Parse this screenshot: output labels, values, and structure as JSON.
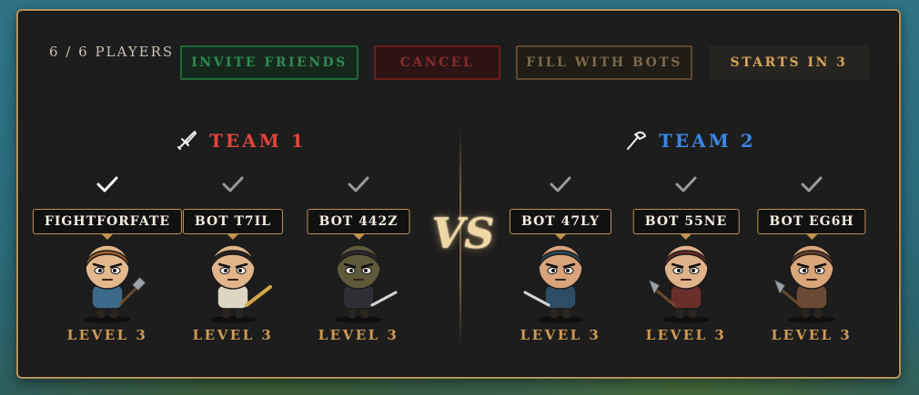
{
  "lobby": {
    "players_count": "6 / 6 PLAYERS",
    "buttons": {
      "invite": "INVITE FRIENDS",
      "cancel": "CANCEL",
      "fill_bots": "FILL WITH BOTS",
      "starts": "STARTS IN 3"
    },
    "vs_label": "VS"
  },
  "teams": [
    {
      "title": "TEAM 1",
      "color": "#e0443a",
      "icon": "sword-icon",
      "players": [
        {
          "name": "FIGHTFORFATE",
          "level": "LEVEL 3",
          "ready": true,
          "hair": "#a4612c",
          "skin": "#e4b88d",
          "shirt": "#3c6a8a",
          "weapon": "hammer"
        },
        {
          "name": "BOT T7IL",
          "level": "LEVEL 3",
          "ready": true,
          "hair": "#2b2622",
          "skin": "#e2b48a",
          "shirt": "#ddd6c2",
          "weapon": "sword"
        },
        {
          "name": "BOT 442Z",
          "level": "LEVEL 3",
          "ready": true,
          "hair": "#2b2b2e",
          "skin": "#5e5a3a",
          "shirt": "#2f3036",
          "weapon": "dagger"
        }
      ]
    },
    {
      "title": "TEAM 2",
      "color": "#3b86e6",
      "icon": "axe-icon",
      "players": [
        {
          "name": "BOT 47LY",
          "level": "LEVEL 3",
          "ready": true,
          "hair": "#2c4a5c",
          "skin": "#d9a37c",
          "shirt": "#2d4d66",
          "weapon": "dagger"
        },
        {
          "name": "BOT 55NE",
          "level": "LEVEL 3",
          "ready": true,
          "hair": "#6b2a28",
          "skin": "#e0b28a",
          "shirt": "#6a2f2b",
          "weapon": "axe"
        },
        {
          "name": "BOT EG6H",
          "level": "LEVEL 3",
          "ready": true,
          "hair": "#6a4430",
          "skin": "#d9a679",
          "shirt": "#6a4a34",
          "weapon": "axe"
        }
      ]
    }
  ]
}
